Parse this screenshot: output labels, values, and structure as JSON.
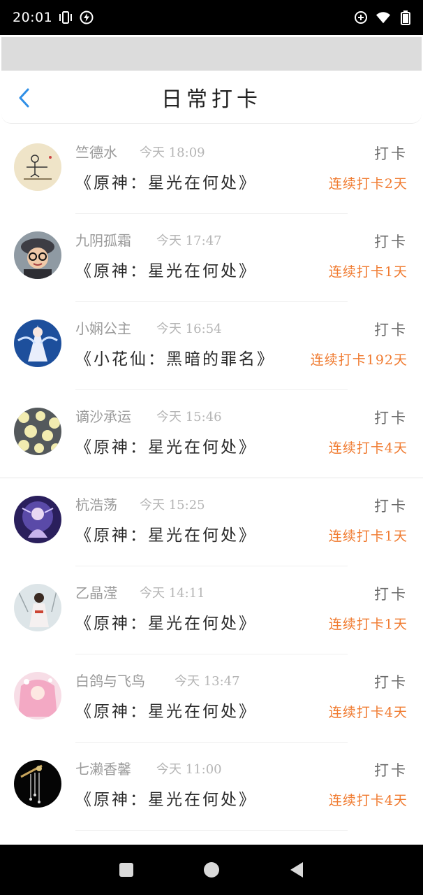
{
  "status_bar": {
    "time": "20:01",
    "icons_left": [
      "vibrate-icon",
      "flash-icon"
    ],
    "icons_right": [
      "data-saver-icon",
      "wifi-icon",
      "battery-icon"
    ]
  },
  "header": {
    "title": "日常打卡",
    "back_icon": "chevron-left-icon",
    "accent_color": "#2f8fe6"
  },
  "colors": {
    "streak": "#f07a2f",
    "name": "#9a9a9a",
    "time": "#b5b5b5"
  },
  "items": [
    {
      "name": "竺德水",
      "time": "今天 18:09",
      "title": "《原神：星光在何处》",
      "action": "打卡",
      "streak": "连续打卡2天"
    },
    {
      "name": "九阴孤霜",
      "time": "今天 17:47",
      "title": "《原神：星光在何处》",
      "action": "打卡",
      "streak": "连续打卡1天"
    },
    {
      "name": "小娴公主",
      "time": "今天 16:54",
      "title": "《小花仙：黑暗的罪名》",
      "action": "打卡",
      "streak": "连续打卡192天"
    },
    {
      "name": "谪沙承运",
      "time": "今天 15:46",
      "title": "《原神：星光在何处》",
      "action": "打卡",
      "streak": "连续打卡4天"
    },
    {
      "name": "杭浩荡",
      "time": "今天 15:25",
      "title": "《原神：星光在何处》",
      "action": "打卡",
      "streak": "连续打卡1天"
    },
    {
      "name": "乙晶滢",
      "time": "今天 14:11",
      "title": "《原神：星光在何处》",
      "action": "打卡",
      "streak": "连续打卡1天"
    },
    {
      "name": "白鸽与飞鸟",
      "time": "今天 13:47",
      "title": "《原神：星光在何处》",
      "action": "打卡",
      "streak": "连续打卡4天"
    },
    {
      "name": "七濑香馨",
      "time": "今天 11:00",
      "title": "《原神：星光在何处》",
      "action": "打卡",
      "streak": "连续打卡4天"
    }
  ],
  "nav_bar": {
    "icons": [
      "recent-apps-icon",
      "home-icon",
      "back-icon"
    ]
  }
}
